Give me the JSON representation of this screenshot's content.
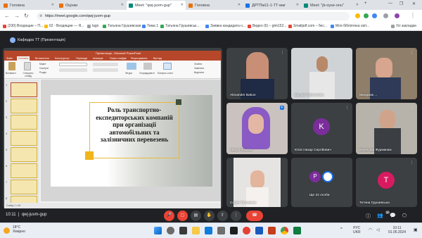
{
  "browser": {
    "tabs": [
      {
        "label": "Головна",
        "active": false
      },
      {
        "label": "Оцінки",
        "active": false
      },
      {
        "label": "Meet: \"qwj-juvm-gup\"",
        "active": true
      },
      {
        "label": "Головна",
        "active": false
      },
      {
        "label": "ДРТПм11-1-ТТ-маг",
        "active": false
      },
      {
        "label": "Meet: \"jb-oyse-onu\"",
        "active": false
      }
    ],
    "new_tab": "+",
    "url": "https://meet.google.com/qwj-juvm-gup",
    "bookmarks": [
      "(230) Входящие – П...",
      "62 - Входящие — Я...",
      "lagn",
      "Татьяна Грушевская",
      "Тема 1",
      "Татьяна Грушевськ...",
      "Заявка кандидата н...",
      "Видео (6) – gtm152...",
      "Smallpdf.com – бес...",
      "Моя бібліотека світ..."
    ],
    "all_bookmarks": "Усі закладки"
  },
  "meet": {
    "presenter_header": "Кафедра ТТ (Презентація)",
    "meeting_time": "10:11",
    "meeting_code": "qwj-juvm-gup",
    "participants": [
      {
        "name": "Alexander Bakun"
      },
      {
        "name": "Danylo Hryhorenko"
      },
      {
        "name": "Мандзюк ..."
      },
      {
        "name": "Інеса Гельзіна"
      },
      {
        "name": "Юсів Назар Сергійович",
        "initial": "K"
      },
      {
        "name": "Вячеслав Фурманюк"
      },
      {
        "name": "Софія Тютюнник"
      },
      {
        "name": "Ще 22 особи",
        "initial": "P"
      },
      {
        "name": "Тетяна Грушевська",
        "initial": "T"
      }
    ],
    "count_badge": "30",
    "colors": {
      "red": "#ea4335",
      "k_avatar": "#7b2d9b",
      "p_avatar": "#7b2d9b",
      "t_avatar": "#d81b60"
    }
  },
  "powerpoint": {
    "window_title": "Презентація - Microsoft PowerPoint",
    "ribbon_tabs": [
      "Файл",
      "Основне",
      "Вставлення",
      "Конструктор",
      "Переходи",
      "Анімація",
      "Показ слайдів",
      "Рецензування",
      "Вигляд"
    ],
    "ribbon_buttons": [
      "Вставити",
      "Створити слайд",
      "Макет",
      "Скинути",
      "Розділ",
      "Фігури",
      "Упорядкувати",
      "Експрес-стилі",
      "Знайти",
      "Замінити",
      "Виділити"
    ],
    "slide_numbers": [
      "1",
      "2",
      "3",
      "4",
      "5",
      "6",
      "7",
      "8",
      "9"
    ],
    "slide_title": "Роль транспортно-експедиторських компаній при організації автомобільних та залізничних перевезень",
    "status": "Слайд 1 з 26"
  },
  "taskbar": {
    "weather_temp": "18°C",
    "weather_desc": "Хмарно",
    "lang": "РУС",
    "lang2": "UKR",
    "time": "10:11",
    "date": "01.05.2024"
  }
}
